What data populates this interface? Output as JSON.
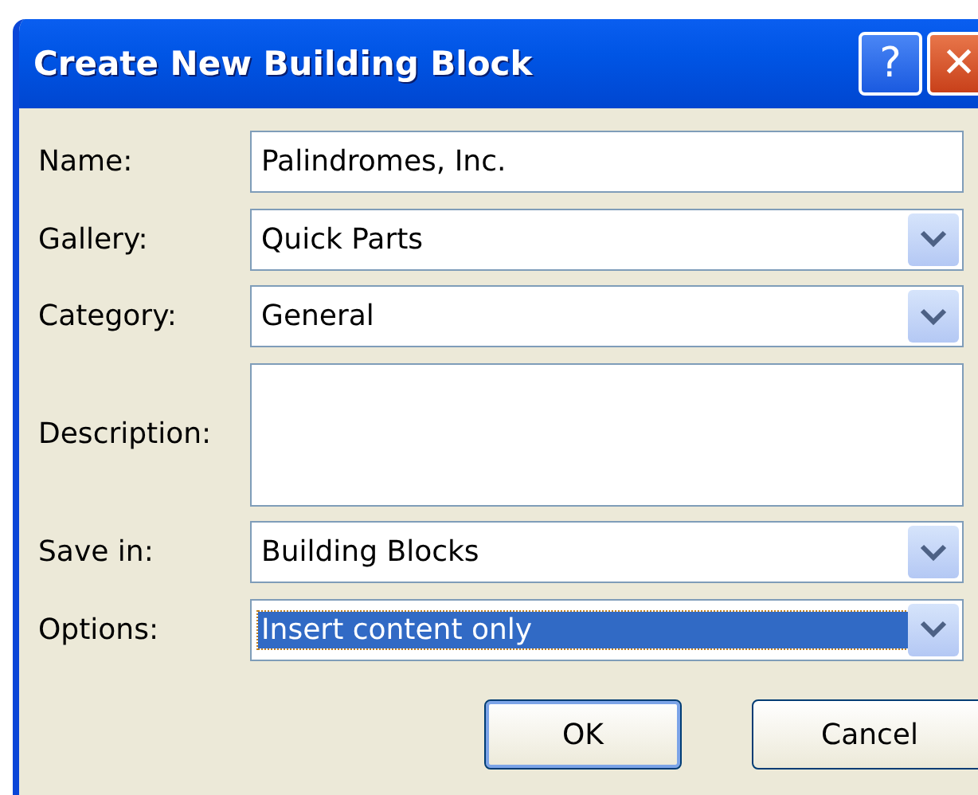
{
  "window": {
    "title": "Create New Building Block",
    "help": "?",
    "close": "✕"
  },
  "fields": [
    {
      "label": "Name:",
      "kind": "text",
      "value": "Palindromes, Inc.",
      "highlighted": false
    },
    {
      "label": "Gallery:",
      "kind": "dropdown",
      "value": "Quick Parts",
      "highlighted": false
    },
    {
      "label": "Category:",
      "kind": "dropdown",
      "value": "General",
      "highlighted": false
    },
    {
      "label": "Description:",
      "kind": "textarea",
      "highlighted": false
    },
    {
      "label": "Save in:",
      "kind": "dropdown",
      "value": "Building Blocks",
      "highlighted": false
    },
    {
      "label": "Options:",
      "kind": "dropdown",
      "value": "Insert content only",
      "highlighted": true
    }
  ],
  "buttons": [
    {
      "label": "OK",
      "default": true
    },
    {
      "label": "Cancel",
      "default": false
    }
  ]
}
